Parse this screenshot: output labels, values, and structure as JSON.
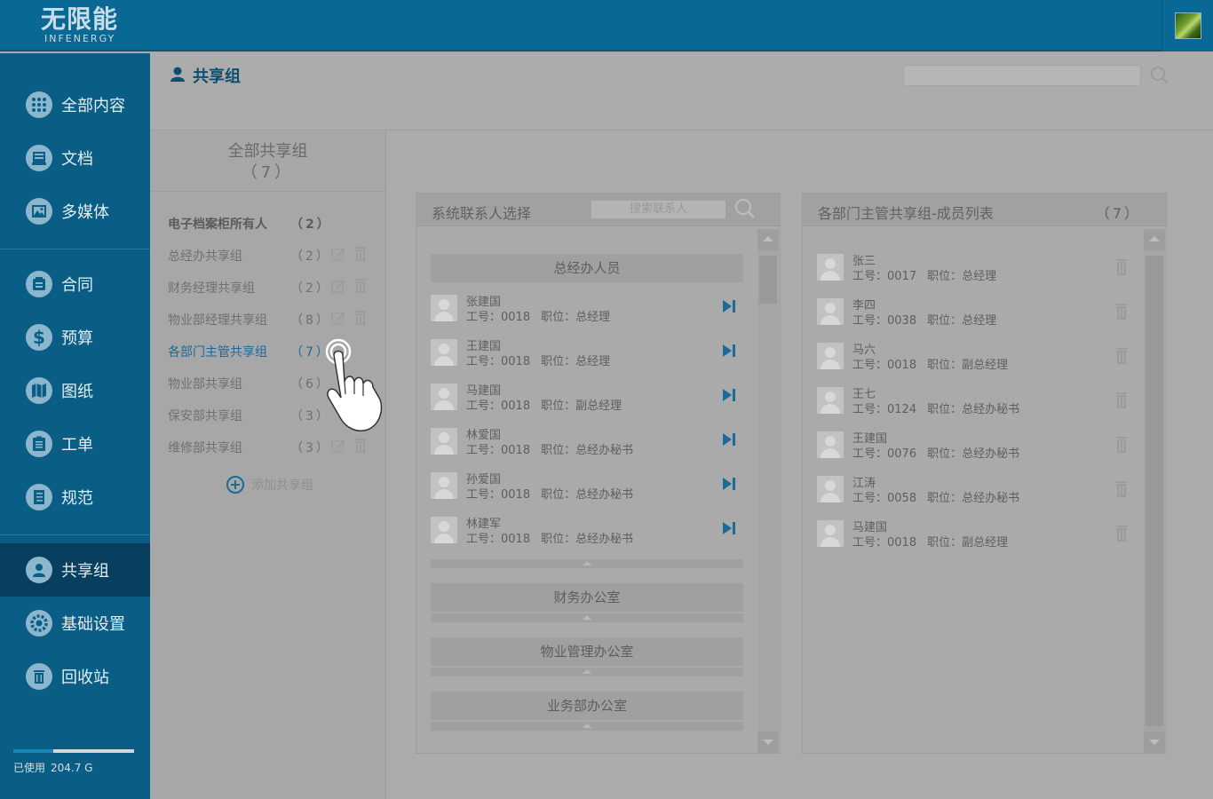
{
  "header": {
    "logo_mark": "无限能",
    "logo_sub": "INFENERGY"
  },
  "sidebar": {
    "items": [
      {
        "label": "全部内容",
        "icon": "grid-icon"
      },
      {
        "label": "文档",
        "icon": "document-icon"
      },
      {
        "label": "多媒体",
        "icon": "image-icon"
      },
      {
        "label": "合同",
        "icon": "contract-icon"
      },
      {
        "label": "预算",
        "icon": "dollar-icon"
      },
      {
        "label": "图纸",
        "icon": "map-icon"
      },
      {
        "label": "工单",
        "icon": "clipboard-icon"
      },
      {
        "label": "规范",
        "icon": "book-icon"
      },
      {
        "label": "共享组",
        "icon": "user-group-icon"
      },
      {
        "label": "基础设置",
        "icon": "gear-icon"
      },
      {
        "label": "回收站",
        "icon": "trash-icon"
      }
    ],
    "active_index": 8,
    "storage": {
      "label": "已使用",
      "value": "204.7 G",
      "fraction": 0.33
    }
  },
  "page": {
    "title": "共享组",
    "search_placeholder": ""
  },
  "groups": {
    "heading": "全部共享组",
    "heading_count": "（7）",
    "items": [
      {
        "name": "电子档案柜所有人",
        "count": "（2）"
      },
      {
        "name": "总经办共享组",
        "count": "（2）"
      },
      {
        "name": "财务经理共享组",
        "count": "（2）"
      },
      {
        "name": "物业部经理共享组",
        "count": "（8）"
      },
      {
        "name": "各部门主管共享组",
        "count": "（7）"
      },
      {
        "name": "物业部共享组",
        "count": "（6）"
      },
      {
        "name": "保安部共享组",
        "count": "（3）"
      },
      {
        "name": "维修部共享组",
        "count": "（3）"
      }
    ],
    "add_label": "添加共享组"
  },
  "contacts": {
    "title": "系统联系人选择",
    "search_placeholder": "搜索联系人",
    "sections": [
      {
        "title": "总经办人员",
        "expanded": true
      },
      {
        "title": "财务办公室",
        "expanded": false
      },
      {
        "title": "物业管理办公室",
        "expanded": false
      },
      {
        "title": "业务部办公室",
        "expanded": false
      }
    ],
    "id_label": "工号：",
    "pos_label": "职位：",
    "people": [
      {
        "name": "张建国",
        "id": "0018",
        "position": "总经理"
      },
      {
        "name": "王建国",
        "id": "0018",
        "position": "总经理"
      },
      {
        "name": "马建国",
        "id": "0018",
        "position": "副总经理"
      },
      {
        "name": "林爱国",
        "id": "0018",
        "position": "总经办秘书"
      },
      {
        "name": "孙爱国",
        "id": "0018",
        "position": "总经办秘书"
      },
      {
        "name": "林建军",
        "id": "0018",
        "position": "总经办秘书"
      }
    ]
  },
  "members": {
    "title": "各部门主管共享组-成员列表",
    "count": "（7）",
    "id_label": "工号：",
    "pos_label": "职位：",
    "people": [
      {
        "name": "张三",
        "id": "0017",
        "position": "总经理"
      },
      {
        "name": "李四",
        "id": "0038",
        "position": "总经理"
      },
      {
        "name": "马六",
        "id": "0018",
        "position": "副总经理"
      },
      {
        "name": "王七",
        "id": "0124",
        "position": "总经办秘书"
      },
      {
        "name": "王建国",
        "id": "0076",
        "position": "总经办秘书"
      },
      {
        "name": "江涛",
        "id": "0058",
        "position": "总经办秘书"
      },
      {
        "name": "马建国",
        "id": "0018",
        "position": "副总经理"
      }
    ]
  },
  "colors": {
    "topbar": "#0a6894",
    "sidebar": "#0a5e86",
    "sidebar_active": "#083f5e",
    "accent": "#1b6a98",
    "overlay_gray": "#ababab"
  }
}
